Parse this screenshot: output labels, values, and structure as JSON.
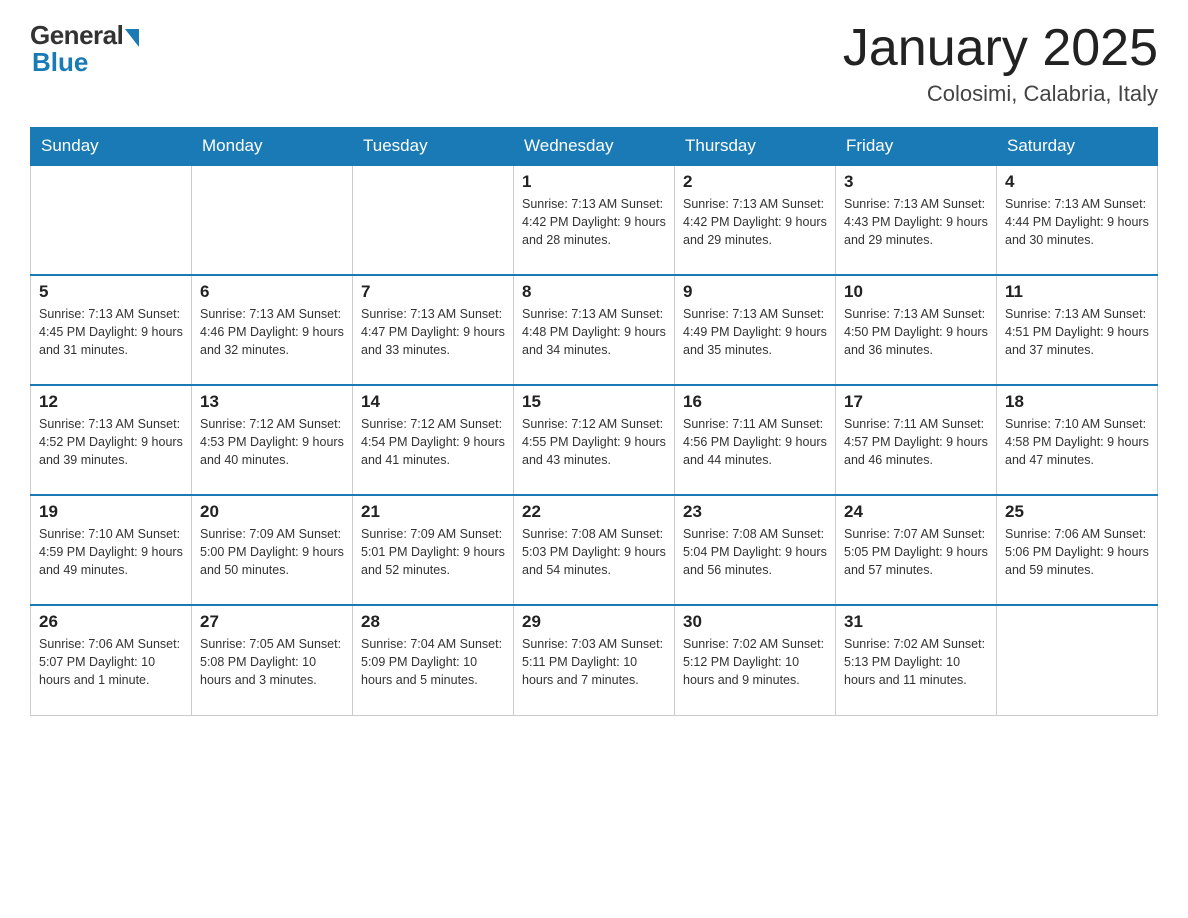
{
  "header": {
    "logo_general": "General",
    "logo_blue": "Blue",
    "month_title": "January 2025",
    "location": "Colosimi, Calabria, Italy"
  },
  "days_of_week": [
    "Sunday",
    "Monday",
    "Tuesday",
    "Wednesday",
    "Thursday",
    "Friday",
    "Saturday"
  ],
  "weeks": [
    [
      {
        "day": "",
        "info": ""
      },
      {
        "day": "",
        "info": ""
      },
      {
        "day": "",
        "info": ""
      },
      {
        "day": "1",
        "info": "Sunrise: 7:13 AM\nSunset: 4:42 PM\nDaylight: 9 hours and 28 minutes."
      },
      {
        "day": "2",
        "info": "Sunrise: 7:13 AM\nSunset: 4:42 PM\nDaylight: 9 hours and 29 minutes."
      },
      {
        "day": "3",
        "info": "Sunrise: 7:13 AM\nSunset: 4:43 PM\nDaylight: 9 hours and 29 minutes."
      },
      {
        "day": "4",
        "info": "Sunrise: 7:13 AM\nSunset: 4:44 PM\nDaylight: 9 hours and 30 minutes."
      }
    ],
    [
      {
        "day": "5",
        "info": "Sunrise: 7:13 AM\nSunset: 4:45 PM\nDaylight: 9 hours and 31 minutes."
      },
      {
        "day": "6",
        "info": "Sunrise: 7:13 AM\nSunset: 4:46 PM\nDaylight: 9 hours and 32 minutes."
      },
      {
        "day": "7",
        "info": "Sunrise: 7:13 AM\nSunset: 4:47 PM\nDaylight: 9 hours and 33 minutes."
      },
      {
        "day": "8",
        "info": "Sunrise: 7:13 AM\nSunset: 4:48 PM\nDaylight: 9 hours and 34 minutes."
      },
      {
        "day": "9",
        "info": "Sunrise: 7:13 AM\nSunset: 4:49 PM\nDaylight: 9 hours and 35 minutes."
      },
      {
        "day": "10",
        "info": "Sunrise: 7:13 AM\nSunset: 4:50 PM\nDaylight: 9 hours and 36 minutes."
      },
      {
        "day": "11",
        "info": "Sunrise: 7:13 AM\nSunset: 4:51 PM\nDaylight: 9 hours and 37 minutes."
      }
    ],
    [
      {
        "day": "12",
        "info": "Sunrise: 7:13 AM\nSunset: 4:52 PM\nDaylight: 9 hours and 39 minutes."
      },
      {
        "day": "13",
        "info": "Sunrise: 7:12 AM\nSunset: 4:53 PM\nDaylight: 9 hours and 40 minutes."
      },
      {
        "day": "14",
        "info": "Sunrise: 7:12 AM\nSunset: 4:54 PM\nDaylight: 9 hours and 41 minutes."
      },
      {
        "day": "15",
        "info": "Sunrise: 7:12 AM\nSunset: 4:55 PM\nDaylight: 9 hours and 43 minutes."
      },
      {
        "day": "16",
        "info": "Sunrise: 7:11 AM\nSunset: 4:56 PM\nDaylight: 9 hours and 44 minutes."
      },
      {
        "day": "17",
        "info": "Sunrise: 7:11 AM\nSunset: 4:57 PM\nDaylight: 9 hours and 46 minutes."
      },
      {
        "day": "18",
        "info": "Sunrise: 7:10 AM\nSunset: 4:58 PM\nDaylight: 9 hours and 47 minutes."
      }
    ],
    [
      {
        "day": "19",
        "info": "Sunrise: 7:10 AM\nSunset: 4:59 PM\nDaylight: 9 hours and 49 minutes."
      },
      {
        "day": "20",
        "info": "Sunrise: 7:09 AM\nSunset: 5:00 PM\nDaylight: 9 hours and 50 minutes."
      },
      {
        "day": "21",
        "info": "Sunrise: 7:09 AM\nSunset: 5:01 PM\nDaylight: 9 hours and 52 minutes."
      },
      {
        "day": "22",
        "info": "Sunrise: 7:08 AM\nSunset: 5:03 PM\nDaylight: 9 hours and 54 minutes."
      },
      {
        "day": "23",
        "info": "Sunrise: 7:08 AM\nSunset: 5:04 PM\nDaylight: 9 hours and 56 minutes."
      },
      {
        "day": "24",
        "info": "Sunrise: 7:07 AM\nSunset: 5:05 PM\nDaylight: 9 hours and 57 minutes."
      },
      {
        "day": "25",
        "info": "Sunrise: 7:06 AM\nSunset: 5:06 PM\nDaylight: 9 hours and 59 minutes."
      }
    ],
    [
      {
        "day": "26",
        "info": "Sunrise: 7:06 AM\nSunset: 5:07 PM\nDaylight: 10 hours and 1 minute."
      },
      {
        "day": "27",
        "info": "Sunrise: 7:05 AM\nSunset: 5:08 PM\nDaylight: 10 hours and 3 minutes."
      },
      {
        "day": "28",
        "info": "Sunrise: 7:04 AM\nSunset: 5:09 PM\nDaylight: 10 hours and 5 minutes."
      },
      {
        "day": "29",
        "info": "Sunrise: 7:03 AM\nSunset: 5:11 PM\nDaylight: 10 hours and 7 minutes."
      },
      {
        "day": "30",
        "info": "Sunrise: 7:02 AM\nSunset: 5:12 PM\nDaylight: 10 hours and 9 minutes."
      },
      {
        "day": "31",
        "info": "Sunrise: 7:02 AM\nSunset: 5:13 PM\nDaylight: 10 hours and 11 minutes."
      },
      {
        "day": "",
        "info": ""
      }
    ]
  ]
}
